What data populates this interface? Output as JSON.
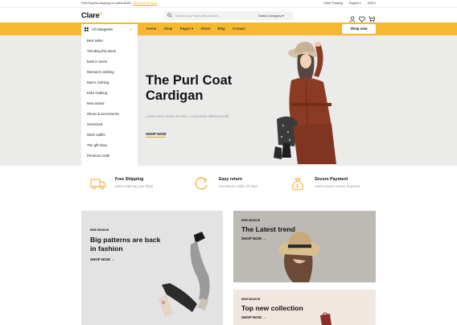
{
  "topbar": {
    "promo_text": "Free Express shipping on orders $100!",
    "promo_cta": "Click here for more",
    "order_tracking": "Order Tracking",
    "language": "English",
    "currency": "USD"
  },
  "header": {
    "logo": "Clare",
    "search_placeholder": "Search your favourite product...",
    "select_category": "Select Category",
    "icons": [
      "user-icon",
      "heart-icon",
      "cart-icon"
    ]
  },
  "nav": {
    "all_categories": "All Categories",
    "links": [
      "Home",
      "Shop",
      "Pages",
      "About",
      "Blog",
      "Contact"
    ],
    "shop_now": "Shop now"
  },
  "categories": [
    "Best seller",
    "Trending this week",
    "back in stock",
    "Woman's clothing",
    "Man's clothing",
    "Kid's clothing",
    "New arrival",
    "Shoes & accessories",
    "Oversized",
    "Work outfits",
    "The gift shop",
    "Premium Cloth"
  ],
  "hero": {
    "title_line1": "The Purl Coat",
    "title_line2": "Cardigan",
    "description": "Lorem ipsum dolor sit amet, consectetur adipiscing elit",
    "button": "SHOP NOW"
  },
  "features": [
    {
      "icon": "truck-icon",
      "title": "Free Shipping",
      "desc": "When ordering over $150"
    },
    {
      "icon": "return-icon",
      "title": "Easy return",
      "desc": "Get Return within 30 days"
    },
    {
      "icon": "money-bag-icon",
      "title": "Secure Payment",
      "desc": "100% Secure Online Payment"
    }
  ],
  "promos": [
    {
      "season": "NEW SEASON",
      "title_line1": "Big patterns are back",
      "title_line2": "in fashion",
      "link": "SHOP NOW →"
    },
    {
      "season": "NEW SEASON",
      "title_line1": "The Latest trend",
      "link": "SHOP NOW →"
    },
    {
      "season": "NEW SEASON",
      "title_line1": "Top new collection",
      "link": "SHOP NOW →"
    }
  ],
  "colors": {
    "accent": "#f5b82e",
    "hero_bg": "#ebebea"
  }
}
